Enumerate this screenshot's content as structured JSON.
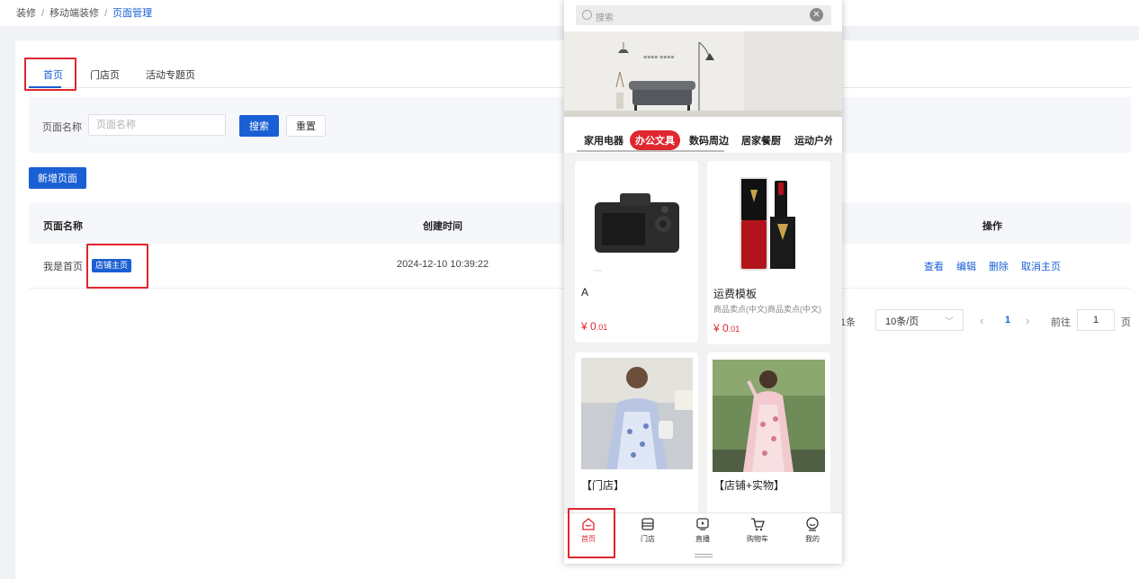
{
  "breadcrumb": {
    "items": [
      "装修",
      "移动端装修"
    ],
    "current": "页面管理"
  },
  "tabs": [
    {
      "label": "首页",
      "active": true
    },
    {
      "label": "门店页"
    },
    {
      "label": "活动专题页"
    }
  ],
  "filter": {
    "label": "页面名称",
    "placeholder": "页面名称",
    "value": "",
    "search_label": "搜索",
    "reset_label": "重置"
  },
  "add_button_label": "新增页面",
  "table": {
    "columns": [
      "页面名称",
      "创建时间",
      "操作"
    ],
    "rows": [
      {
        "name": "我是首页",
        "tag": "店铺主页",
        "created": "2024-12-10 10:39:22",
        "actions": [
          "查看",
          "编辑",
          "删除",
          "取消主页"
        ]
      }
    ]
  },
  "pagination": {
    "total_text": "共1条",
    "page_size": "10条/页",
    "prev": "‹",
    "current_page": "1",
    "next": "›",
    "goto_label": "前往",
    "goto_value": "1",
    "page_unit": "页"
  },
  "phone": {
    "search_placeholder": "搜索",
    "banner_text": "▪▪▪▪ ▪▪▪▪",
    "categories": [
      "家用电器",
      "办公文具",
      "数码周边",
      "居家餐厨",
      "运动户外"
    ],
    "active_category": "办公文具",
    "products": [
      {
        "title": "A",
        "subtitle": "",
        "price_int": "¥ 0",
        "price_dec": ".01",
        "image": "camera"
      },
      {
        "title": "运费模板",
        "subtitle": "商品卖点(中文)商品卖点(中文)",
        "price_int": "¥ 0",
        "price_dec": ".01",
        "image": "lipstick"
      },
      {
        "title": "【门店】",
        "subtitle": "",
        "price_int": "",
        "price_dec": "",
        "image": "dress-photo"
      },
      {
        "title": "【店铺+实物】",
        "subtitle": "",
        "price_int": "",
        "price_dec": "",
        "image": "dress-photo"
      }
    ],
    "nav": [
      {
        "label": "首页",
        "icon": "home-icon",
        "active": true
      },
      {
        "label": "门店",
        "icon": "store-icon"
      },
      {
        "label": "直播",
        "icon": "live-icon"
      },
      {
        "label": "购物车",
        "icon": "cart-icon"
      },
      {
        "label": "我的",
        "icon": "profile-icon"
      }
    ]
  },
  "colors": {
    "primary": "#1a5fd4",
    "highlight_red": "#e0262e",
    "accent_red": "#e0262e"
  }
}
